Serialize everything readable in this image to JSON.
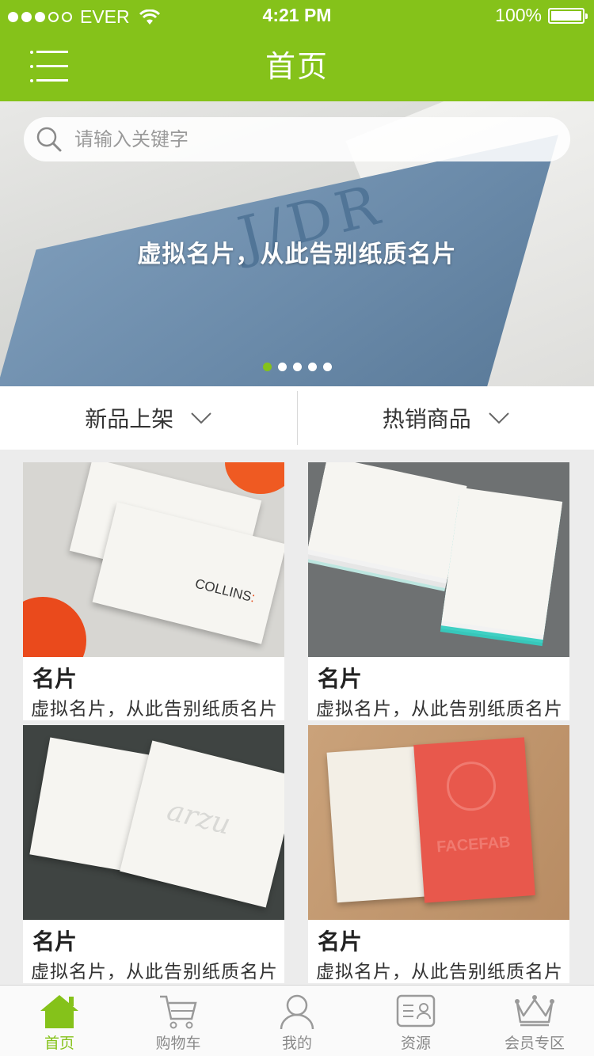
{
  "status": {
    "carrier": "EVER",
    "time": "4:21 PM",
    "battery": "100%"
  },
  "header": {
    "title": "首页"
  },
  "search": {
    "placeholder": "请输入关键字"
  },
  "banner": {
    "caption": "虚拟名片，从此告别纸质名片",
    "slides": 5,
    "active_slide": 0
  },
  "tabs": [
    {
      "label": "新品上架"
    },
    {
      "label": "热销商品"
    }
  ],
  "products": [
    {
      "name": "名片",
      "desc": "虚拟名片，从此告别纸质名片",
      "image": "collins-business-card"
    },
    {
      "name": "名片",
      "desc": "虚拟名片，从此告别纸质名片",
      "image": "stacked-cards-teal-edges"
    },
    {
      "name": "名片",
      "desc": "虚拟名片，从此告别纸质名片",
      "image": "arzu-studio-hope-card"
    },
    {
      "name": "名片",
      "desc": "虚拟名片，从此告别纸质名片",
      "image": "facefab-red-cards"
    }
  ],
  "nav": {
    "active": 0,
    "items": [
      {
        "label": "首页",
        "icon": "home-icon"
      },
      {
        "label": "购物车",
        "icon": "cart-icon"
      },
      {
        "label": "我的",
        "icon": "user-icon"
      },
      {
        "label": "资源",
        "icon": "id-card-icon"
      },
      {
        "label": "会员专区",
        "icon": "crown-icon"
      }
    ]
  },
  "colors": {
    "brand": "#85c21a"
  }
}
